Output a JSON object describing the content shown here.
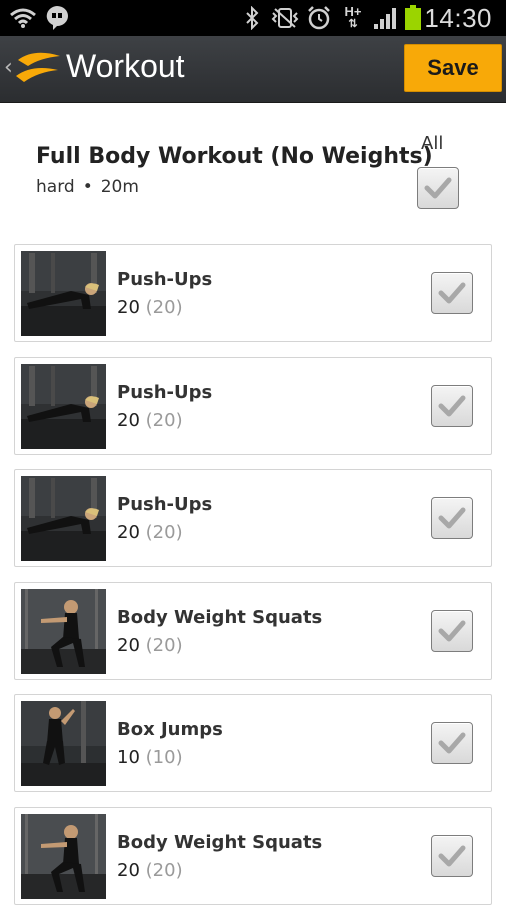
{
  "status_bar": {
    "time": "14:30",
    "icons": [
      "wifi-icon",
      "hangouts-icon",
      "bluetooth-icon",
      "vibrate-icon",
      "alarm-icon",
      "hplus-network-icon",
      "signal-icon",
      "battery-icon"
    ],
    "network_label": "H+"
  },
  "action_bar": {
    "title": "Workout",
    "save_label": "Save",
    "accent": "#f8a908"
  },
  "workout": {
    "name": "Full Body Workout (No Weights)",
    "difficulty": "hard",
    "separator": "•",
    "duration": "20m",
    "all_label": "All",
    "all_checked": true
  },
  "exercises": [
    {
      "name": "Push-Ups",
      "reps": "20",
      "target": "(20)",
      "checked": true,
      "thumb": "pushup"
    },
    {
      "name": "Push-Ups",
      "reps": "20",
      "target": "(20)",
      "checked": true,
      "thumb": "pushup"
    },
    {
      "name": "Push-Ups",
      "reps": "20",
      "target": "(20)",
      "checked": true,
      "thumb": "pushup"
    },
    {
      "name": "Body Weight Squats",
      "reps": "20",
      "target": "(20)",
      "checked": true,
      "thumb": "squat"
    },
    {
      "name": "Box Jumps",
      "reps": "10",
      "target": "(10)",
      "checked": true,
      "thumb": "boxjump"
    },
    {
      "name": "Body Weight Squats",
      "reps": "20",
      "target": "(20)",
      "checked": true,
      "thumb": "squat"
    }
  ]
}
